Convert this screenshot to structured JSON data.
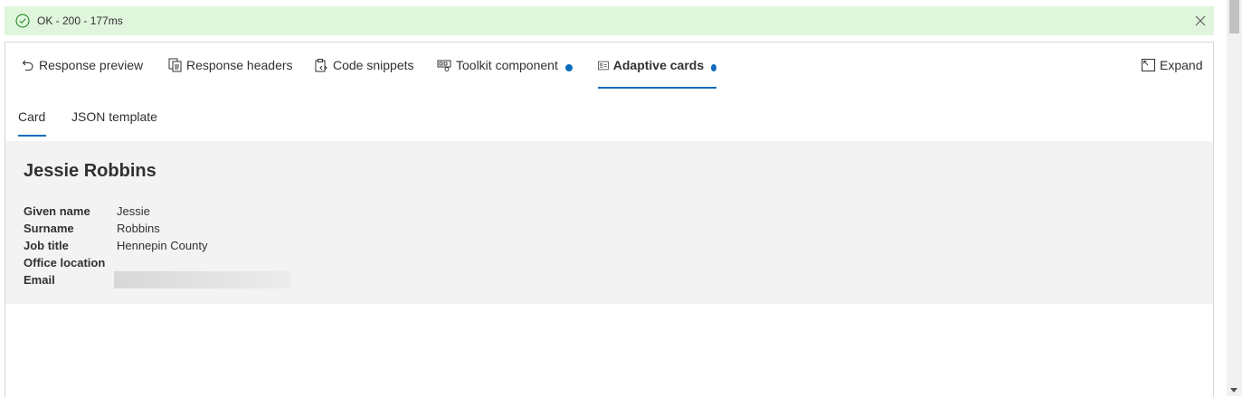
{
  "status": {
    "text": "OK - 200 - 177ms",
    "color": "#dff6dd"
  },
  "tabs": [
    {
      "label": "Response preview",
      "icon": "undo-icon"
    },
    {
      "label": "Response headers",
      "icon": "document-copy-icon"
    },
    {
      "label": "Code snippets",
      "icon": "clipboard-code-icon"
    },
    {
      "label": "Toolkit component",
      "icon": "toolkit-icon"
    },
    {
      "label": "Adaptive cards",
      "icon": "contact-card-icon"
    }
  ],
  "expand_label": "Expand",
  "subtabs": [
    {
      "label": "Card"
    },
    {
      "label": "JSON template"
    }
  ],
  "card": {
    "name": "Jessie Robbins",
    "facts": [
      {
        "key": "Given name",
        "value": "Jessie"
      },
      {
        "key": "Surname",
        "value": "Robbins"
      },
      {
        "key": "Job title",
        "value": "Hennepin County"
      },
      {
        "key": "Office location",
        "value": ""
      },
      {
        "key": "Email",
        "value": ""
      }
    ]
  },
  "accent_color": "#0f6cbd"
}
